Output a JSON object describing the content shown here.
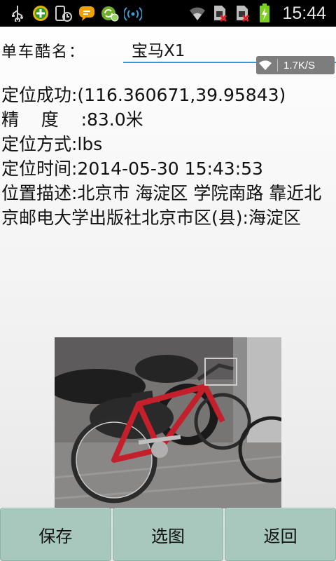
{
  "status_bar": {
    "time": "15:44",
    "icons_left": [
      "usb-icon",
      "app-plus-icon",
      "phone-battery-icon",
      "chat-icon",
      "sync-icon",
      "wifi-broadcast-icon"
    ],
    "icons_right": [
      "wifi-icon",
      "sim1-no-signal-icon",
      "sim2-no-signal-icon",
      "battery-charging-icon"
    ]
  },
  "form": {
    "name_label": "单车酷名：",
    "name_value": "宝马X1"
  },
  "speed_badge": {
    "text": "1.7K/S"
  },
  "info": {
    "line1": "定位成功:(116.360671,39.95843)",
    "line2": "精    度    :83.0米",
    "line3": "定位方式:lbs",
    "line4": "定位时间:2014-05-30 15:43:53",
    "line5": "位置描述:北京市 海淀区 学院南路 靠近北京邮电大学出版社北京市区(县):海淀区"
  },
  "buttons": {
    "save": "保存",
    "pick": "选图",
    "back": "返回"
  }
}
